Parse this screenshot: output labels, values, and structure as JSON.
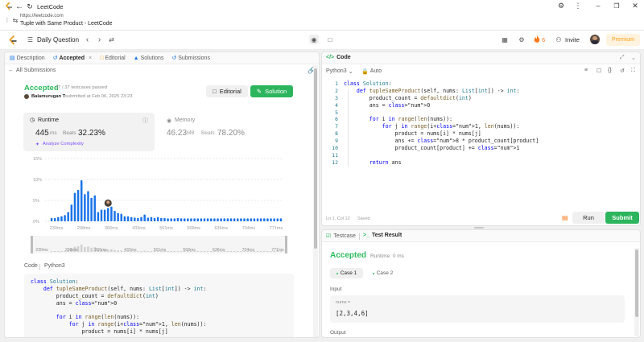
{
  "browser": {
    "tab_title": "LeetCode",
    "url": "https://leetcode.com",
    "page_title": "Tuple with Same Product - LeetCode"
  },
  "topbar": {
    "daily_label": "Daily Question",
    "streak_count": "6",
    "invite_label": "Invite",
    "premium_label": "Premium"
  },
  "left": {
    "tabs": [
      {
        "label": "Description",
        "icon": "description-icon"
      },
      {
        "label": "Accepted",
        "icon": "history-icon"
      },
      {
        "label": "Editorial",
        "icon": "book-icon"
      },
      {
        "label": "Solutions",
        "icon": "flask-icon"
      },
      {
        "label": "Submissions",
        "icon": "history-icon"
      }
    ],
    "all_submissions": "All Submissions",
    "status": "Accepted",
    "testcases": "37 / 37 testcases passed",
    "user": "Balamurugan T",
    "submitted_at": "submitted at Feb 06, 2025 23:23",
    "editorial_btn": "Editorial",
    "solution_btn": "Solution",
    "runtime_label": "Runtime",
    "runtime_value": "445",
    "runtime_unit": "ms",
    "beats_label": "Beats",
    "runtime_beats": "32.23%",
    "analyze_label": "Analyze Complexity",
    "memory_label": "Memory",
    "memory_value": "46.23",
    "memory_unit": "MB",
    "memory_beats": "78.20%",
    "code_label": "Code",
    "code_lang": "Python3",
    "code_lines": [
      "class Solution:",
      "    def tupleSameProduct(self, nums: List[int]) -> int:",
      "        product_count = defaultdict(int)",
      "        ans = 0",
      "",
      "        for i in range(len(nums)):",
      "            for j in range(i+1, len(nums)):",
      "                product = nums[i] * nums[j]"
    ]
  },
  "chart_data": {
    "type": "bar",
    "y_ticks": [
      "15%",
      "10%",
      "5%",
      "0%"
    ],
    "ylim": [
      0,
      15
    ],
    "x_ticks": [
      "230ms",
      "298ms",
      "366ms",
      "433ms",
      "501ms",
      "568ms",
      "636ms",
      "704ms",
      "771ms"
    ],
    "nav_ticks": [
      "230ms",
      "298ms",
      "366ms",
      "433ms",
      "501ms",
      "568ms",
      "636ms",
      "704ms",
      "771ms"
    ],
    "values": [
      0.8,
      0.8,
      1.0,
      1.2,
      1.5,
      2.2,
      4.0,
      6.8,
      7.5,
      9.8,
      6.5,
      7.2,
      5.6,
      6.2,
      2.2,
      2.8,
      2.8,
      3.2,
      3.5,
      2.5,
      2.0,
      1.8,
      1.2,
      1.2,
      1.0,
      0.9,
      0.8,
      1.0,
      1.6,
      0.9,
      1.0,
      0.8,
      1.0,
      0.8,
      0.8,
      0.7,
      0.7,
      0.7,
      0.8,
      0.7,
      0.7,
      0.7,
      0.7,
      0.7,
      0.7,
      0.7,
      0.7,
      0.7,
      0.7,
      0.7,
      0.7,
      0.7,
      0.7,
      0.7,
      0.7,
      0.7,
      0.7,
      0.7,
      0.7,
      0.7,
      0.7,
      0.7,
      0.7,
      0.7,
      0.7,
      0.7,
      0.7,
      0.7,
      0.7,
      0.7
    ],
    "highlight_index": 17,
    "color": "#1a73e8"
  },
  "editor": {
    "title": "Code",
    "lang": "Python3",
    "auto_label": "Auto",
    "line_numbers": [
      "1",
      "2",
      "3",
      "4",
      "5",
      "6",
      "7",
      "8",
      "9",
      "10",
      "11",
      "12"
    ],
    "lines": [
      "class Solution:",
      "    def tupleSameProduct(self, nums: List[int]) -> int:",
      "        product_count = defaultdict(int)",
      "        ans = 0",
      "",
      "        for i in range(len(nums)):",
      "            for j in range(i+1, len(nums)):",
      "                product = nums[i] * nums[j]",
      "                ans += 8 * product_count[product]",
      "                product_count[product] += 1",
      "",
      "        return ans"
    ],
    "cursor_pos": "Ln 1, Col 12",
    "saved": "Saved",
    "run_btn": "Run",
    "submit_btn": "Submit"
  },
  "console": {
    "testcase_tab": "Testcase",
    "result_tab": "Test Result",
    "status": "Accepted",
    "runtime": "Runtime: 0 ms",
    "cases": [
      "Case 1",
      "Case 2"
    ],
    "input_label": "Input",
    "var_name": "nums =",
    "var_value": "[2,3,4,6]",
    "output_label": "Output"
  },
  "colors": {
    "accent_green": "#2db55d",
    "accepted_green": "#2cbb5d",
    "orange": "#ffa116",
    "blue_link": "#1a73e8"
  }
}
